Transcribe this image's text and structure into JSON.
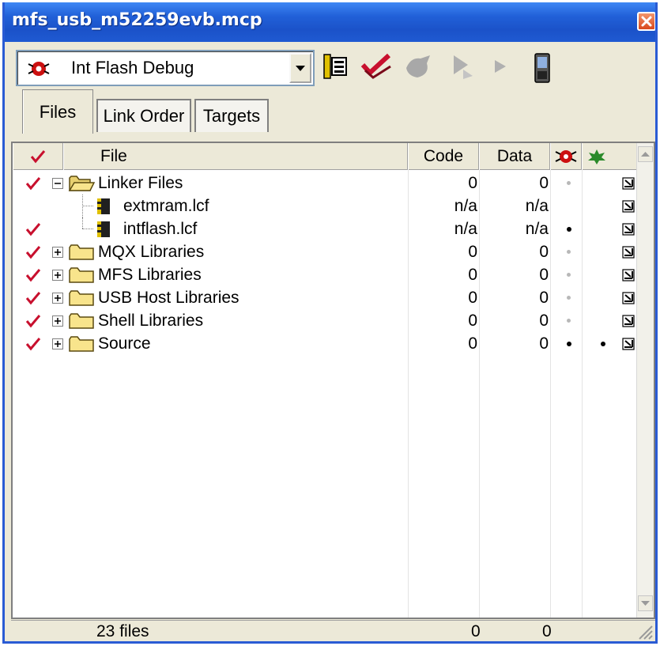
{
  "window": {
    "title": "mfs_usb_m52259evb.mcp"
  },
  "toolbar": {
    "target": "Int Flash Debug"
  },
  "tabs": [
    {
      "label": "Files"
    },
    {
      "label": "Link Order"
    },
    {
      "label": "Targets"
    }
  ],
  "columns": {
    "file": "File",
    "code": "Code",
    "data": "Data"
  },
  "rows": [
    {
      "name": "Linker Files",
      "code": "0",
      "data": "0"
    },
    {
      "name": "extmram.lcf",
      "code": "n/a",
      "data": "n/a"
    },
    {
      "name": "intflash.lcf",
      "code": "n/a",
      "data": "n/a"
    },
    {
      "name": "MQX Libraries",
      "code": "0",
      "data": "0"
    },
    {
      "name": "MFS Libraries",
      "code": "0",
      "data": "0"
    },
    {
      "name": "USB Host Libraries",
      "code": "0",
      "data": "0"
    },
    {
      "name": "Shell Libraries",
      "code": "0",
      "data": "0"
    },
    {
      "name": "Source",
      "code": "0",
      "data": "0"
    }
  ],
  "status": {
    "files": "23 files",
    "code_total": "0",
    "data_total": "0"
  },
  "icons": {
    "close": "close-icon",
    "target": "debug-target-icon",
    "settings": "target-settings-icon",
    "check": "check-icon",
    "make": "make-icon",
    "debug": "debug-icon",
    "run": "run-icon",
    "board": "device-icon",
    "folder": "folder-icon",
    "file": "lcf-file-icon"
  },
  "colors": {
    "titlebar": "#2160d8",
    "check": "#c8102e",
    "bug": "#cc1010",
    "leaf": "#2a8a2a",
    "folder": "#f8e48c"
  }
}
